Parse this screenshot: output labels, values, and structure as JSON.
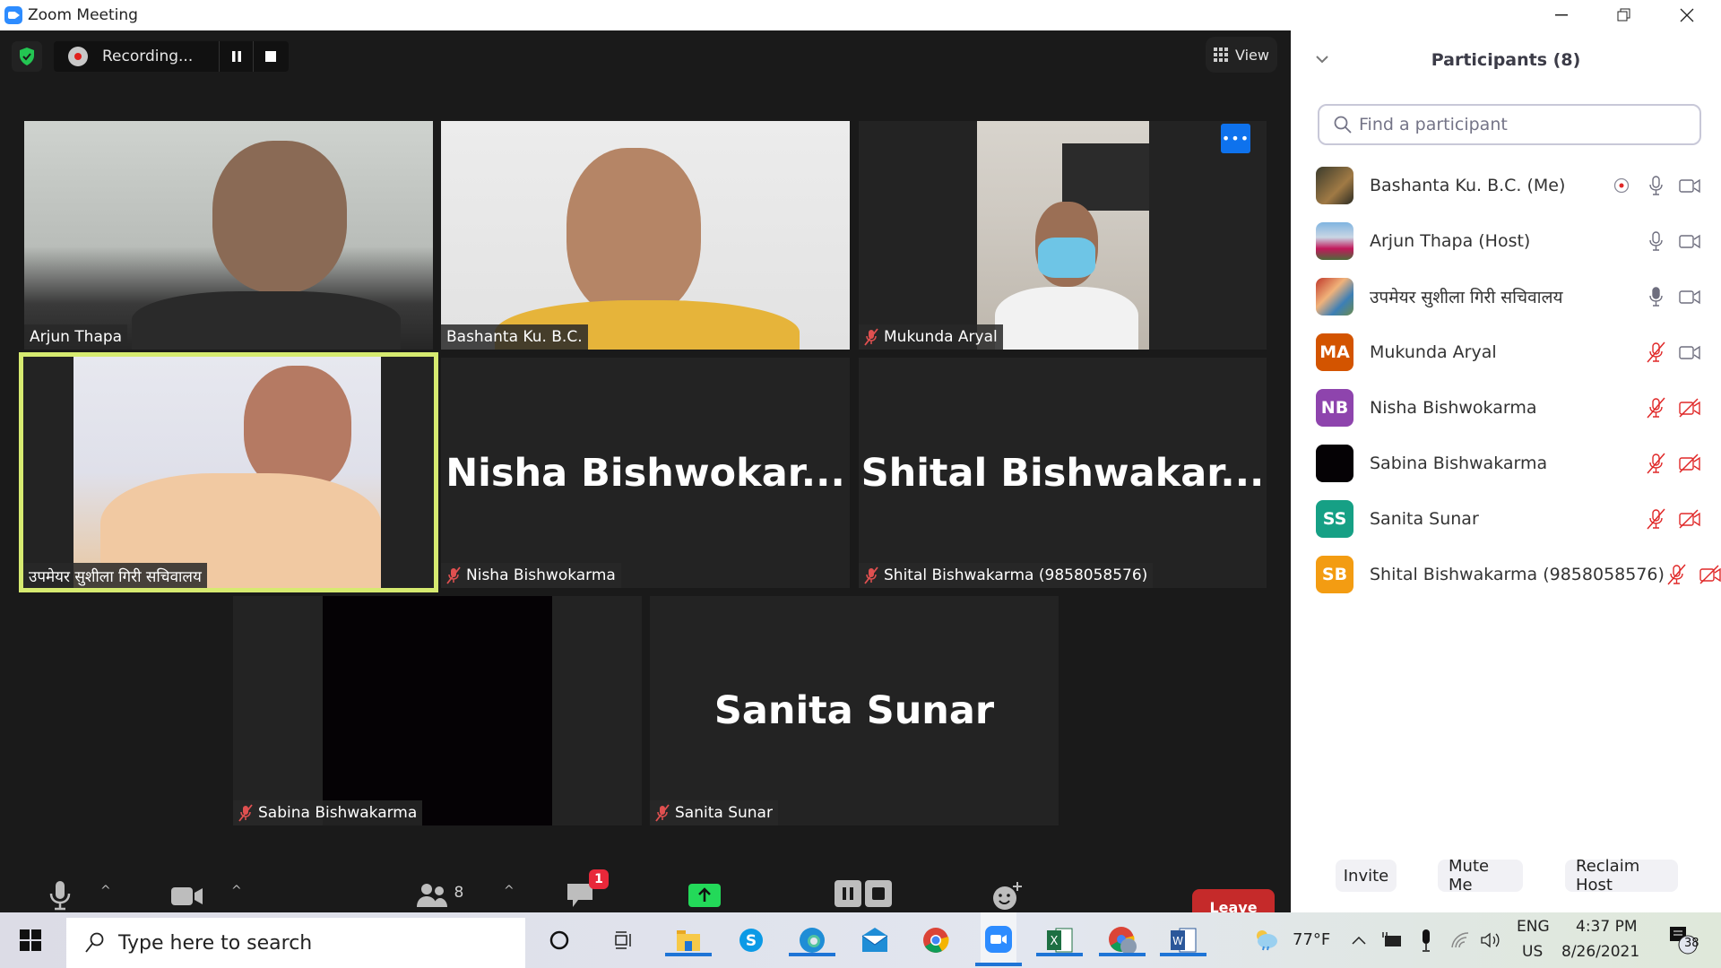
{
  "window": {
    "title": "Zoom Meeting",
    "controls": [
      "minimize",
      "restore",
      "close"
    ]
  },
  "meeting_topbar": {
    "recording_label": "Recording...",
    "view_label": "View"
  },
  "tiles": [
    {
      "name": "Arjun Thapa",
      "muted": false,
      "video": true,
      "big_name": ""
    },
    {
      "name": "Bashanta Ku. B.C.",
      "muted": false,
      "video": true,
      "big_name": ""
    },
    {
      "name": "Mukunda Aryal",
      "muted": true,
      "video": true,
      "big_name": ""
    },
    {
      "name": "उपमेयर सुशीला गिरी सचिवालय",
      "muted": false,
      "video": true,
      "active_speaker": true,
      "big_name": ""
    },
    {
      "name": "Nisha Bishwokarma",
      "muted": true,
      "video": false,
      "big_name": "Nisha  Bishwokar..."
    },
    {
      "name": "Shital Bishwakarma (9858058576)",
      "muted": true,
      "video": false,
      "big_name": "Shital  Bishwakar..."
    },
    {
      "name": "Sabina Bishwakarma",
      "muted": true,
      "video": true,
      "big_name": ""
    },
    {
      "name": "Sanita  Sunar",
      "muted": true,
      "video": false,
      "big_name": "Sanita  Sunar"
    }
  ],
  "toolbar": {
    "mute": "Mute",
    "stop_video": "Stop Video",
    "participants": "Participants",
    "participants_count": "8",
    "chat": "Chat",
    "chat_badge": "1",
    "share_screen": "Share Screen",
    "pause_stop_recording": "Pause/Stop Recording",
    "reactions": "Reactions",
    "leave": "Leave"
  },
  "participants_panel": {
    "title": "Participants (8)",
    "search_placeholder": "Find a participant",
    "participants": [
      {
        "name": "Bashanta Ku. B.C. (Me)",
        "avatar": "photo",
        "recording": true,
        "mic": "on",
        "video": "on"
      },
      {
        "name": "Arjun Thapa (Host)",
        "avatar": "photo",
        "recording": false,
        "mic": "on",
        "video": "on"
      },
      {
        "name": "उपमेयर सुशीला गिरी सचिवालय",
        "avatar": "photo",
        "recording": false,
        "mic": "speaking",
        "video": "on"
      },
      {
        "name": "Mukunda Aryal",
        "avatar": "MA",
        "avatar_color": "#d35400",
        "mic": "muted",
        "video": "on"
      },
      {
        "name": "Nisha Bishwokarma",
        "avatar": "NB",
        "avatar_color": "#8e44ad",
        "mic": "muted",
        "video": "off"
      },
      {
        "name": "Sabina Bishwakarma",
        "avatar": "",
        "avatar_color": "#050205",
        "mic": "muted",
        "video": "off"
      },
      {
        "name": "Sanita  Sunar",
        "avatar": "SS",
        "avatar_color": "#16a085",
        "mic": "muted",
        "video": "off"
      },
      {
        "name": "Shital Bishwakarma (9858058576)",
        "avatar": "SB",
        "avatar_color": "#f39c12",
        "mic": "muted",
        "video": "off"
      }
    ],
    "buttons": {
      "invite": "Invite",
      "mute_me": "Mute Me",
      "reclaim_host": "Reclaim Host"
    }
  },
  "taskbar": {
    "search_placeholder": "Type here to search",
    "weather": "77°F",
    "language_top": "ENG",
    "language_bottom": "US",
    "time": "4:37 PM",
    "date": "8/26/2021",
    "notifications": "38",
    "apps": [
      "cortana",
      "task-view",
      "file-explorer",
      "skype",
      "edge",
      "mail",
      "chrome",
      "zoom",
      "excel",
      "chrome-profile",
      "word"
    ]
  },
  "colors": {
    "accent_blue": "#0e72ed",
    "leave_red": "#c52a2a",
    "share_green": "#23d959",
    "active_speaker": "#d6ea70",
    "muted_red": "#e02828"
  }
}
